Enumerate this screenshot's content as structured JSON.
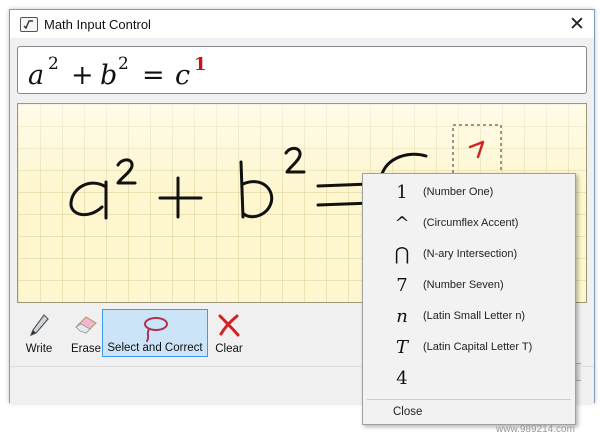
{
  "window": {
    "title": "Math Input Control",
    "close_glyph": "✕",
    "icon": "math-input-icon"
  },
  "preview": {
    "expression": {
      "a": "a",
      "exp1": "2",
      "plus": "+",
      "b": "b",
      "exp2": "2",
      "equals": "=",
      "c": "c",
      "exp3": "1"
    },
    "highlight_color": "#cc1111"
  },
  "toolbar": {
    "tools": [
      {
        "label": "Write",
        "icon": "pen-icon"
      },
      {
        "label": "Erase",
        "icon": "eraser-icon"
      },
      {
        "label": "Select and Correct",
        "icon": "lasso-icon"
      },
      {
        "label": "Clear",
        "icon": "clear-x-icon"
      }
    ],
    "active_tool": "Select and Correct"
  },
  "correction_menu": {
    "items": [
      {
        "symbol": "1",
        "name": "(Number One)"
      },
      {
        "symbol": "^",
        "name": "(Circumflex Accent)"
      },
      {
        "symbol": "⋂",
        "name": "(N-ary Intersection)"
      },
      {
        "symbol": "7",
        "name": "(Number Seven)"
      },
      {
        "symbol": "n",
        "name": "(Latin Small Letter n)"
      },
      {
        "symbol": "T",
        "name": "(Latin Capital Letter T)"
      },
      {
        "symbol": "4",
        "name": ""
      }
    ],
    "close_label": "Close"
  },
  "watermark": "www.989214.com",
  "colors": {
    "ink": "#111111",
    "selection_ink": "#d42020",
    "pad_background": "#fdf6cf",
    "active_tool_background": "#cce4f7",
    "active_tool_border": "#3c9ae8"
  }
}
